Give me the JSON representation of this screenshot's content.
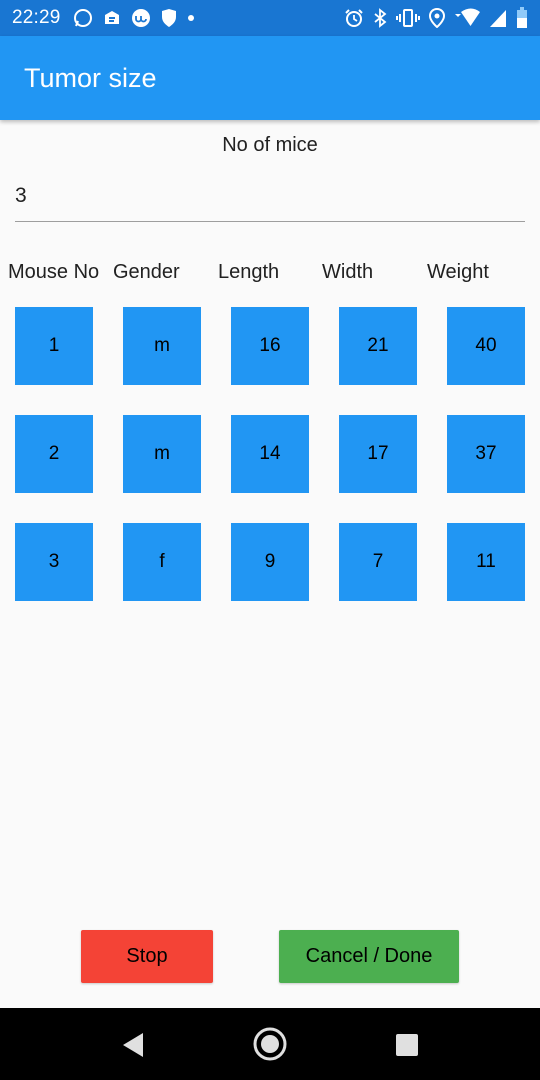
{
  "status_bar": {
    "time": "22:29",
    "left_icons": [
      "whatsapp-icon",
      "notification-app-icon",
      "upwork-icon",
      "shield-icon",
      "dot-icon"
    ],
    "right_icons": [
      "alarm-icon",
      "bluetooth-icon",
      "vibrate-icon",
      "location-icon",
      "wifi-icon",
      "signal-icon",
      "battery-icon"
    ]
  },
  "app_bar": {
    "title": "Tumor size"
  },
  "mice_count": {
    "label": "No of mice",
    "value": "3"
  },
  "table": {
    "headers": [
      "Mouse No",
      "Gender",
      "Length",
      "Width",
      "Weight"
    ],
    "rows": [
      [
        "1",
        "m",
        "16",
        "21",
        "40"
      ],
      [
        "2",
        "m",
        "14",
        "17",
        "37"
      ],
      [
        "3",
        "f",
        "9",
        "7",
        "11"
      ]
    ]
  },
  "buttons": {
    "stop": "Stop",
    "done": "Cancel / Done"
  },
  "colors": {
    "status_bar": "#1976d2",
    "app_bar": "#2196f3",
    "cell": "#2196f3",
    "stop": "#f44336",
    "done": "#4caf50"
  },
  "nav_bar": {
    "icons": [
      "back-icon",
      "home-icon",
      "recents-icon"
    ]
  }
}
